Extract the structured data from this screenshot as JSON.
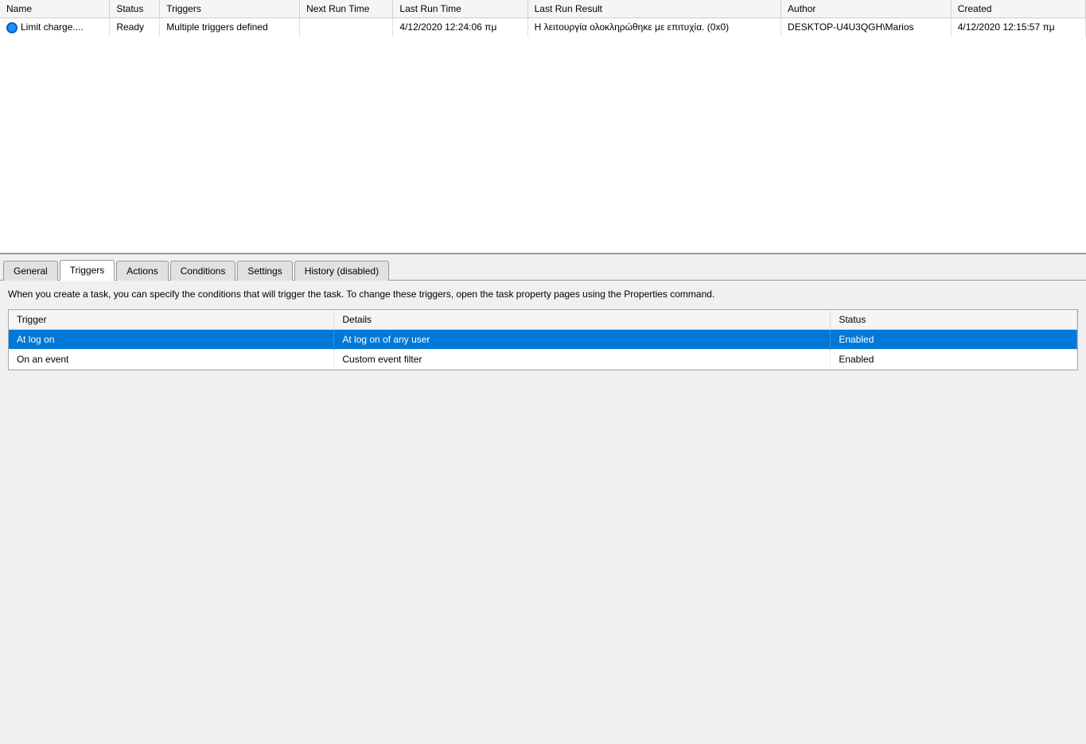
{
  "topPanel": {
    "columns": [
      "Name",
      "Status",
      "Triggers",
      "Next Run Time",
      "Last Run Time",
      "Last Run Result",
      "Author",
      "Created"
    ],
    "rows": [
      {
        "name": "Limit charge....",
        "status": "Ready",
        "triggers": "Multiple triggers defined",
        "nextRunTime": "",
        "lastRunTime": "4/12/2020 12:24:06 πμ",
        "lastRunResult": "Η λειτουργία ολοκληρώθηκε με επιτυχία. (0x0)",
        "author": "DESKTOP-U4U3QGH\\Marios",
        "created": "4/12/2020 12:15:57 πμ"
      }
    ]
  },
  "tabs": [
    {
      "id": "general",
      "label": "General",
      "active": false
    },
    {
      "id": "triggers",
      "label": "Triggers",
      "active": true
    },
    {
      "id": "actions",
      "label": "Actions",
      "active": false
    },
    {
      "id": "conditions",
      "label": "Conditions",
      "active": false
    },
    {
      "id": "settings",
      "label": "Settings",
      "active": false
    },
    {
      "id": "history",
      "label": "History (disabled)",
      "active": false
    }
  ],
  "triggersPanel": {
    "description": "When you create a task, you can specify the conditions that will trigger the task.  To change these triggers, open the task property pages using the Properties command.",
    "columns": [
      "Trigger",
      "Details",
      "Status"
    ],
    "rows": [
      {
        "trigger": "At log on",
        "details": "At log on of any user",
        "status": "Enabled",
        "selected": true
      },
      {
        "trigger": "On an event",
        "details": "Custom event filter",
        "status": "Enabled",
        "selected": false
      }
    ]
  }
}
